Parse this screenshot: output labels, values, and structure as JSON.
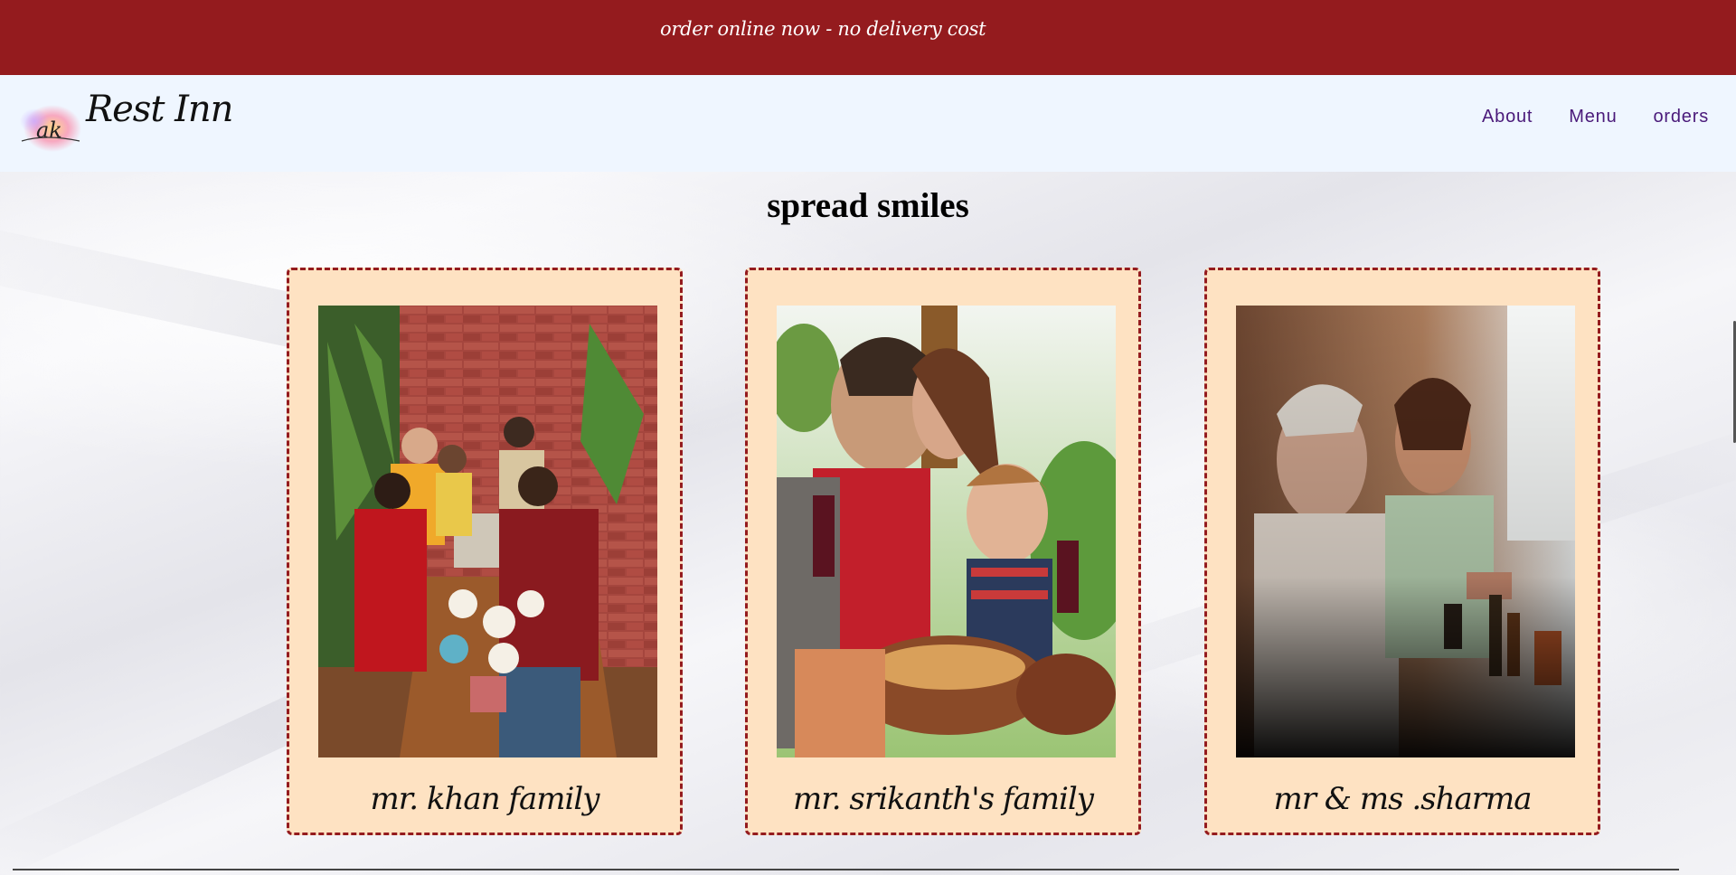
{
  "banner": {
    "text": "order online now - no delivery cost"
  },
  "header": {
    "logo_badge_text": "ak",
    "logo_text": "Rest Inn",
    "nav": [
      {
        "label": "About"
      },
      {
        "label": "Menu"
      },
      {
        "label": "orders"
      }
    ]
  },
  "main": {
    "title": "spread smiles",
    "cards": [
      {
        "caption": "mr. khan family",
        "photo": "family-dining-photo"
      },
      {
        "caption": "mr. srikanth's family",
        "photo": "family-eating-outdoors-photo"
      },
      {
        "caption": "mr & ms .sharma",
        "photo": "couple-dining-photo"
      }
    ]
  },
  "colors": {
    "banner_bg": "#941b1e",
    "navbar_bg": "#eff6ff",
    "nav_link": "#4a1a7a",
    "card_bg": "#fee2c2",
    "card_border": "#941b1e"
  }
}
